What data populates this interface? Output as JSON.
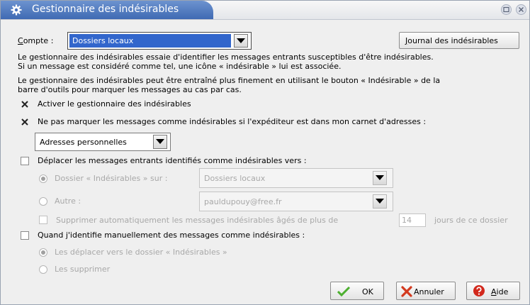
{
  "window": {
    "title": "Gestionnaire des indésirables"
  },
  "account": {
    "label_first": "C",
    "label_rest": "ompte :",
    "value": "Dossiers locaux"
  },
  "junk_log_button": {
    "first": "J",
    "rest": "ournal des indésirables"
  },
  "paragraphs": {
    "p1": "Le gestionnaire des indésirables essaie d'identifier les messages entrants susceptibles d'être indésirables.",
    "p2": "Si un message est considéré comme tel, une icône « indésirable » lui est associée.",
    "p3": "Le gestionnaire des indésirables peut être entraîné plus finement en utilisant le bouton « Indésirable » de la",
    "p4": "barre d'outils pour marquer les messages au cas par cas."
  },
  "options": {
    "enable": {
      "label": "Activer le gestionnaire des indésirables",
      "checked": true
    },
    "whitelist": {
      "label": "Ne pas marquer les messages comme indésirables si l'expéditeur est dans mon carnet d'adresses :",
      "checked": true
    },
    "addressbook": "Adresses personnelles",
    "move": {
      "label": "Déplacer les messages entrants identifiés comme indésirables vers :",
      "checked": false
    },
    "folder_radio": {
      "label": "Dossier « Indésirables » sur :",
      "selected": true
    },
    "folder_value": "Dossiers locaux",
    "other_radio": {
      "label": "Autre :",
      "selected": false
    },
    "other_value": "pauldupouy@free.fr",
    "purge": {
      "label": "Supprimer automatiquement les messages indésirables âgés de plus de",
      "value": "14",
      "suffix": "jours de ce dossier",
      "checked": false
    },
    "manual": {
      "label": "Quand j'identifie manuellement des messages comme indésirables :",
      "checked": false
    },
    "manual_move": {
      "label": "Les déplacer vers le dossier « Indésirables »",
      "selected": true
    },
    "manual_delete": {
      "label": "Les supprimer",
      "selected": false
    }
  },
  "buttons": {
    "ok": "OK",
    "cancel": "Annuler",
    "help_first": "A",
    "help_rest": "ide"
  },
  "colors": {
    "title_blue": "#4a74bd",
    "selection_blue": "#3266cc",
    "ok_green": "#4caf2f",
    "cancel_red": "#d33a1f",
    "help_red": "#d2291d"
  },
  "icons": {
    "app": "gear-icon",
    "ok": "checkmark-icon",
    "cancel": "cross-icon",
    "help": "help-icon"
  }
}
